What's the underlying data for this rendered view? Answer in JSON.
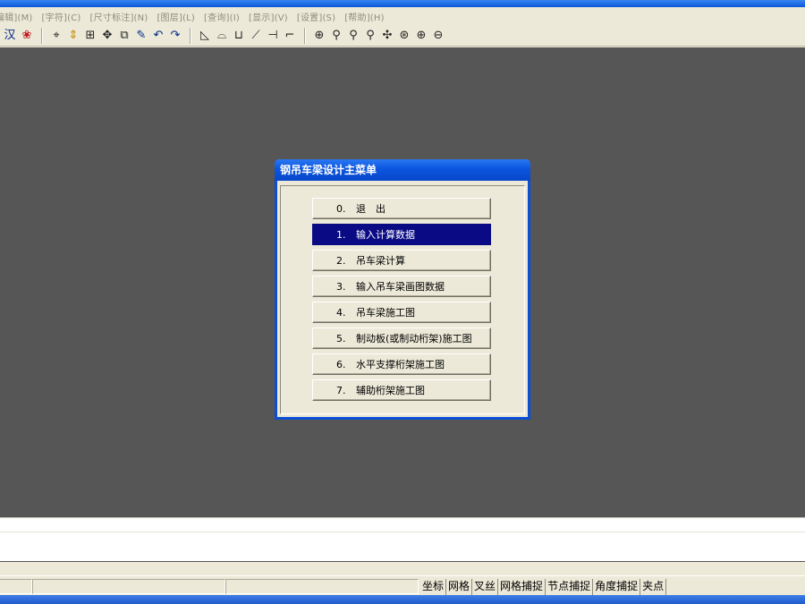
{
  "menubar": {
    "items": [
      "编辑](M)",
      "[字符](C)",
      "[尺寸标注](N)",
      "[图层](L)",
      "[查询](I)",
      "[显示](V)",
      "[设置](S)",
      "[帮助](H)"
    ]
  },
  "toolbar": {
    "icons": [
      "hanzi-icon",
      "brush-icon",
      "crosshair-icon",
      "updown-arrow-icon",
      "grid-icon",
      "move-icon",
      "copy-icon",
      "pencil-icon",
      "undo-icon",
      "redo-icon",
      "rect-icon",
      "arc-icon",
      "box-icon",
      "line-icon",
      "trim-icon",
      "corner-icon",
      "zoom-window-icon",
      "zoom-realtime-icon",
      "zoom-previous-icon",
      "zoom-icon",
      "pan-icon",
      "zoom-extent-icon",
      "zoom-in-icon",
      "zoom-out-icon"
    ],
    "hanzi_glyph": "汉"
  },
  "dialog": {
    "title": "钢吊车梁设计主菜单",
    "items": [
      {
        "num": "0.",
        "label": "退　出",
        "selected": false
      },
      {
        "num": "1.",
        "label": "输入计算数据",
        "selected": true
      },
      {
        "num": "2.",
        "label": "吊车梁计算",
        "selected": false
      },
      {
        "num": "3.",
        "label": "输入吊车梁画图数据",
        "selected": false
      },
      {
        "num": "4.",
        "label": "吊车梁施工图",
        "selected": false
      },
      {
        "num": "5.",
        "label": "制动板(或制动桁架)施工图",
        "selected": false
      },
      {
        "num": "6.",
        "label": "水平支撑桁架施工图",
        "selected": false
      },
      {
        "num": "7.",
        "label": "辅助桁架施工图",
        "selected": false
      }
    ]
  },
  "statusbar": {
    "toggles": [
      "坐标",
      "网格",
      "叉丝",
      "网格捕捉",
      "节点捕捉",
      "角度捕捉",
      "夹点"
    ]
  },
  "colors": {
    "canvas": "#565656",
    "selection": "#0a0a84",
    "title_blue": "#0a55df"
  }
}
